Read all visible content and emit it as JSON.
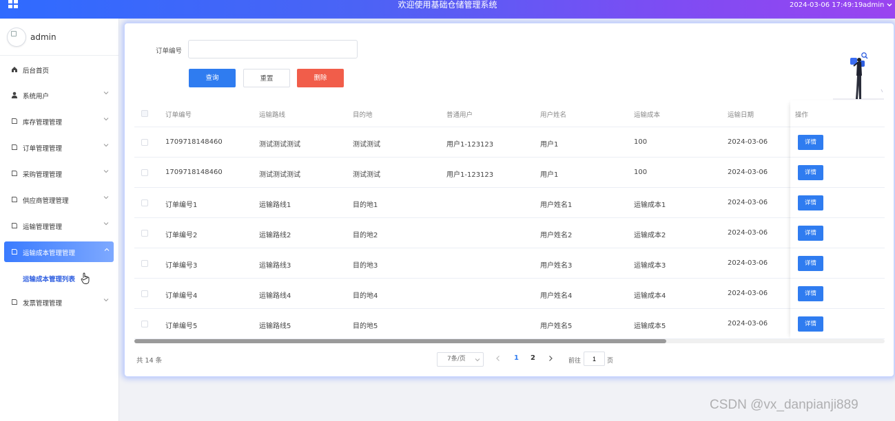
{
  "header": {
    "title": "欢迎使用基础仓储管理系统",
    "datetime": "2024-03-06 17:49:19",
    "user": "admin"
  },
  "sidebar": {
    "user_name": "admin",
    "items": [
      {
        "label": "后台首页",
        "icon": "home-icon"
      },
      {
        "label": "系统用户",
        "icon": "user-icon"
      },
      {
        "label": "库存管理管理",
        "icon": "document-icon"
      },
      {
        "label": "订单管理管理",
        "icon": "document-icon"
      },
      {
        "label": "采购管理管理",
        "icon": "document-icon"
      },
      {
        "label": "供应商管理管理",
        "icon": "document-icon"
      },
      {
        "label": "运输管理管理",
        "icon": "document-icon"
      },
      {
        "label": "运输成本管理管理",
        "icon": "document-icon"
      },
      {
        "label": "发票管理管理",
        "icon": "document-icon"
      }
    ],
    "active_sub_item": "运输成本管理列表"
  },
  "search": {
    "label": "订单编号",
    "value": "",
    "placeholder": "",
    "query_label": "查询",
    "reset_label": "重置",
    "delete_label": "删除"
  },
  "table": {
    "columns": [
      "订单编号",
      "运输路线",
      "目的地",
      "普通用户",
      "用户姓名",
      "运输成本",
      "运输日期",
      "操作"
    ],
    "detail_label": "详情",
    "rows": [
      [
        "1709718148460",
        "测试测试测试",
        "测试测试",
        "用户1-123123",
        "用户1",
        "100",
        "2024-03-06"
      ],
      [
        "1709718148460",
        "测试测试测试",
        "测试测试",
        "用户1-123123",
        "用户1",
        "100",
        "2024-03-06"
      ],
      [
        "订单编号1",
        "运输路线1",
        "目的地1",
        "",
        "用户姓名1",
        "运输成本1",
        "2024-03-06"
      ],
      [
        "订单编号2",
        "运输路线2",
        "目的地2",
        "",
        "用户姓名2",
        "运输成本2",
        "2024-03-06"
      ],
      [
        "订单编号3",
        "运输路线3",
        "目的地3",
        "",
        "用户姓名3",
        "运输成本3",
        "2024-03-06"
      ],
      [
        "订单编号4",
        "运输路线4",
        "目的地4",
        "",
        "用户姓名4",
        "运输成本4",
        "2024-03-06"
      ],
      [
        "订单编号5",
        "运输路线5",
        "目的地5",
        "",
        "用户姓名5",
        "运输成本5",
        "2024-03-06"
      ]
    ]
  },
  "pagination": {
    "total": "共 14 条",
    "page_size": "7条/页",
    "pages": [
      "1",
      "2"
    ],
    "current_page": "1",
    "goto_label": "前往",
    "goto_value": "1",
    "goto_suffix": "页"
  },
  "watermark": "CSDN @vx_danpianji889",
  "colors": {
    "primary": "#2f7cf0",
    "danger": "#f15d4a",
    "header_start": "#2f6bff",
    "header_end": "#9a44f0"
  }
}
